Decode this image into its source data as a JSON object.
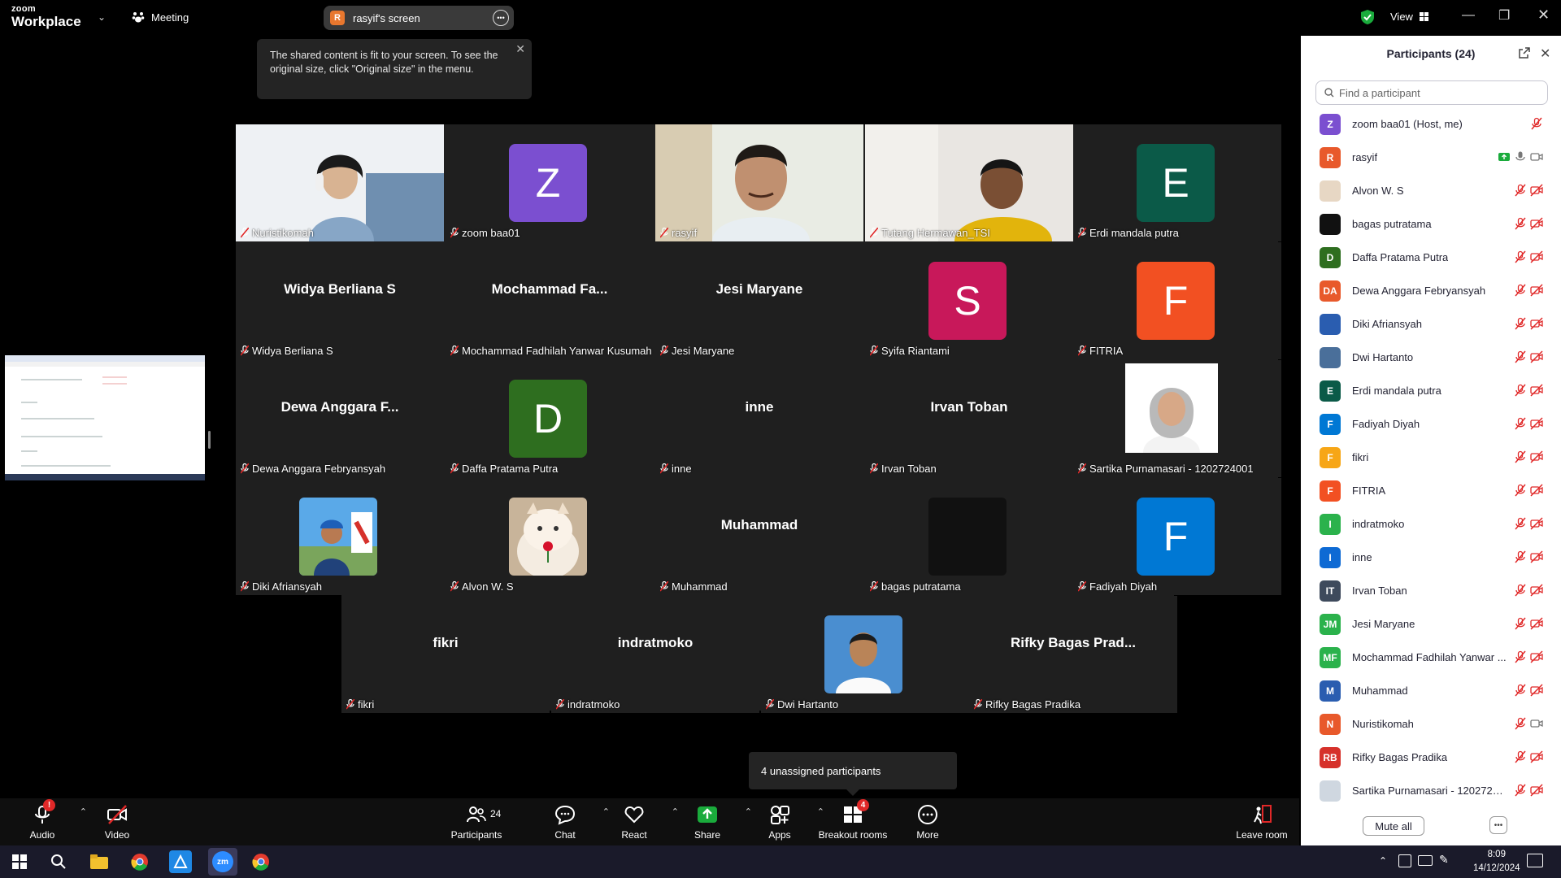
{
  "titlebar": {
    "brand_top": "zoom",
    "brand_bottom": "Workplace",
    "meeting_label": "Meeting",
    "screen_tab_initial": "R",
    "screen_tab_label": "rasyif's screen",
    "view_label": "View"
  },
  "tooltip": {
    "text": "The shared content is fit to your screen. To see the original size, click \"Original size\" in the menu."
  },
  "tiles": [
    {
      "name": "Nuristikomah",
      "type": "video"
    },
    {
      "name": "zoom baa01",
      "type": "avatar",
      "initial": "Z",
      "color": "#7b4fd0"
    },
    {
      "name": "rasyif",
      "type": "video",
      "active": true
    },
    {
      "name": "Tutang Hermawan_TSI",
      "type": "video"
    },
    {
      "name": "Erdi mandala putra",
      "type": "avatar",
      "initial": "E",
      "color": "#0b5a48"
    },
    {
      "name": "Widya Berliana S",
      "type": "text",
      "display": "Widya Berliana S"
    },
    {
      "name": "Mochammad Fadhilah Yanwar Kusumah",
      "type": "text",
      "display": "Mochammad  Fa..."
    },
    {
      "name": "Jesi Maryane",
      "type": "text",
      "display": "Jesi Maryane"
    },
    {
      "name": "Syifa Riantami",
      "type": "avatar",
      "initial": "S",
      "color": "#c8185a"
    },
    {
      "name": "FITRIA",
      "type": "avatar",
      "initial": "F",
      "color": "#f25022"
    },
    {
      "name": "Dewa Anggara Febryansyah",
      "type": "text",
      "display": "Dewa Anggara F..."
    },
    {
      "name": "Daffa Pratama Putra",
      "type": "avatar",
      "initial": "D",
      "color": "#2e6e1f"
    },
    {
      "name": "inne",
      "type": "text",
      "display": "inne"
    },
    {
      "name": "Irvan Toban",
      "type": "text",
      "display": "Irvan Toban"
    },
    {
      "name": "Sartika Purnamasari - 1202724001",
      "type": "photo"
    },
    {
      "name": "Diki Afriansyah",
      "type": "photo"
    },
    {
      "name": "Alvon W. S",
      "type": "photo"
    },
    {
      "name": "Muhammad",
      "type": "text",
      "display": "Muhammad"
    },
    {
      "name": "bagas putratama",
      "type": "dark"
    },
    {
      "name": "Fadiyah Diyah",
      "type": "avatar",
      "initial": "F",
      "color": "#0078d4"
    },
    {
      "name": "fikri",
      "type": "text",
      "display": "fikri"
    },
    {
      "name": "indratmoko",
      "type": "text",
      "display": "indratmoko"
    },
    {
      "name": "Dwi Hartanto",
      "type": "photo"
    },
    {
      "name": "Rifky Bagas Pradika",
      "type": "text",
      "display": "Rifky Bagas Prad..."
    }
  ],
  "unassigned": "4 unassigned participants",
  "toolbar": {
    "audio": "Audio",
    "video": "Video",
    "participants": "Participants",
    "participants_count": "24",
    "chat": "Chat",
    "react": "React",
    "share": "Share",
    "apps": "Apps",
    "breakout": "Breakout rooms",
    "breakout_badge": "4",
    "more": "More",
    "leave": "Leave room"
  },
  "panel": {
    "title": "Participants (24)",
    "search_placeholder": "Find a participant",
    "mute_all": "Mute all",
    "participants": [
      {
        "name": "zoom baa01 (Host, me)",
        "initial": "Z",
        "color": "#7b4fd0"
      },
      {
        "name": "rasyif",
        "initial": "R",
        "color": "#e8592b"
      },
      {
        "name": "Alvon W. S",
        "initial": "",
        "color": "#e7d7c4"
      },
      {
        "name": "bagas putratama",
        "initial": "",
        "color": "#111111"
      },
      {
        "name": "Daffa Pratama Putra",
        "initial": "D",
        "color": "#2e6e1f"
      },
      {
        "name": "Dewa Anggara Febryansyah",
        "initial": "DA",
        "color": "#e8592b"
      },
      {
        "name": "Diki Afriansyah",
        "initial": "",
        "color": "#2a5db0"
      },
      {
        "name": "Dwi Hartanto",
        "initial": "",
        "color": "#4a6f9a"
      },
      {
        "name": "Erdi mandala putra",
        "initial": "E",
        "color": "#0b5a48"
      },
      {
        "name": "Fadiyah Diyah",
        "initial": "F",
        "color": "#0078d4"
      },
      {
        "name": "fikri",
        "initial": "F",
        "color": "#f7a616"
      },
      {
        "name": "FITRIA",
        "initial": "F",
        "color": "#f25022"
      },
      {
        "name": "indratmoko",
        "initial": "I",
        "color": "#2bb24c"
      },
      {
        "name": "inne",
        "initial": "I",
        "color": "#0e6ad4"
      },
      {
        "name": "Irvan Toban",
        "initial": "IT",
        "color": "#3e4a5c"
      },
      {
        "name": "Jesi Maryane",
        "initial": "JM",
        "color": "#2bb24c"
      },
      {
        "name": "Mochammad Fadhilah Yanwar ...",
        "initial": "MF",
        "color": "#2bb24c"
      },
      {
        "name": "Muhammad",
        "initial": "M",
        "color": "#2a5db0"
      },
      {
        "name": "Nuristikomah",
        "initial": "N",
        "color": "#e8592b"
      },
      {
        "name": "Rifky Bagas Pradika",
        "initial": "RB",
        "color": "#d6312b"
      },
      {
        "name": "Sartika Purnamasari - 1202724...",
        "initial": "",
        "color": "#cfd7e0"
      }
    ]
  },
  "taskbar": {
    "time": "8:09",
    "date": "14/12/2024"
  }
}
